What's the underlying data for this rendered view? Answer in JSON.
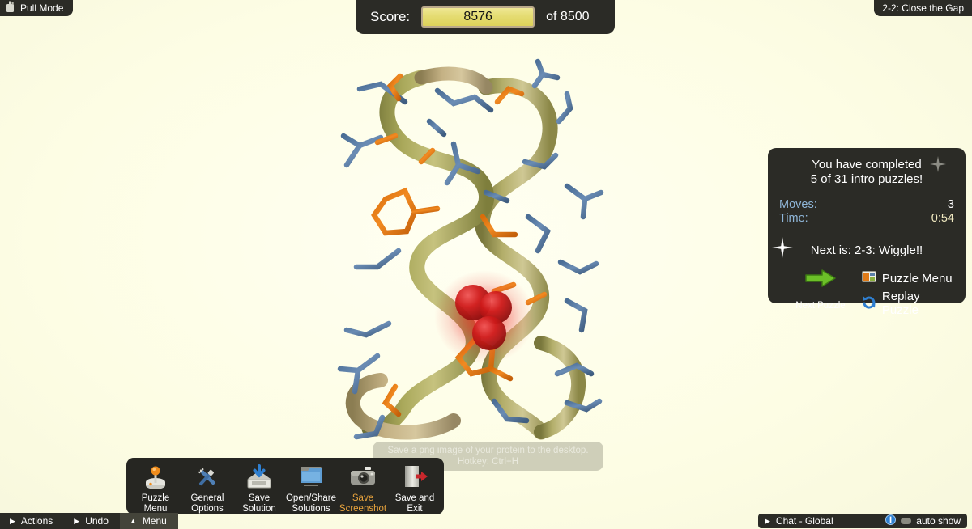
{
  "app": {
    "background_color": "#fffff0",
    "panel_color": "#2b2b26"
  },
  "pull_mode": {
    "label": "Pull Mode",
    "icon": "hand-cursor-icon"
  },
  "score": {
    "label": "Score:",
    "value": "8576",
    "target": "of 8500",
    "box_color": "#e5dc72"
  },
  "puzzle": {
    "name": "2-2: Close the Gap"
  },
  "completion": {
    "title_line1": "You have completed",
    "title_line2": "5 of 31 intro puzzles!",
    "moves_label": "Moves:",
    "moves_value": "3",
    "time_label": "Time:",
    "time_value": "0:54",
    "next_is": "Next is: 2-3: Wiggle!!",
    "next_puzzle_label": "Next Puzzle",
    "puzzle_menu_label": "Puzzle Menu",
    "replay_puzzle_label": "Replay Puzzle",
    "label_color": "#8fb6d8",
    "time_color": "#f0e9c0"
  },
  "tooltip": {
    "line1": "Save a png image of your protein to the desktop.",
    "line2": "Hotkey: Ctrl+H"
  },
  "menu": {
    "items": [
      {
        "label_line1": "Puzzle",
        "label_line2": "Menu",
        "icon": "joystick-icon",
        "highlighted": false
      },
      {
        "label_line1": "General",
        "label_line2": "Options",
        "icon": "tools-icon",
        "highlighted": false
      },
      {
        "label_line1": "Save",
        "label_line2": "Solution",
        "icon": "save-disk-icon",
        "highlighted": false
      },
      {
        "label_line1": "Open/Share",
        "label_line2": "Solutions",
        "icon": "folder-icon",
        "highlighted": false
      },
      {
        "label_line1": "Save",
        "label_line2": "Screenshot",
        "icon": "camera-icon",
        "highlighted": true
      },
      {
        "label_line1": "Save and",
        "label_line2": "Exit",
        "icon": "exit-door-icon",
        "highlighted": false
      }
    ],
    "highlight_color": "#e8a33d"
  },
  "status_bar": {
    "actions_label": "Actions",
    "undo_label": "Undo",
    "menu_label": "Menu",
    "chat_label": "Chat - Global",
    "auto_show_label": "auto show"
  },
  "protein": {
    "backbone_color": "#a8a656",
    "sidechain_blue": "#5a7fa8",
    "sidechain_orange": "#e07b18",
    "clash_color": "#cc1414",
    "clash_count": 3
  }
}
